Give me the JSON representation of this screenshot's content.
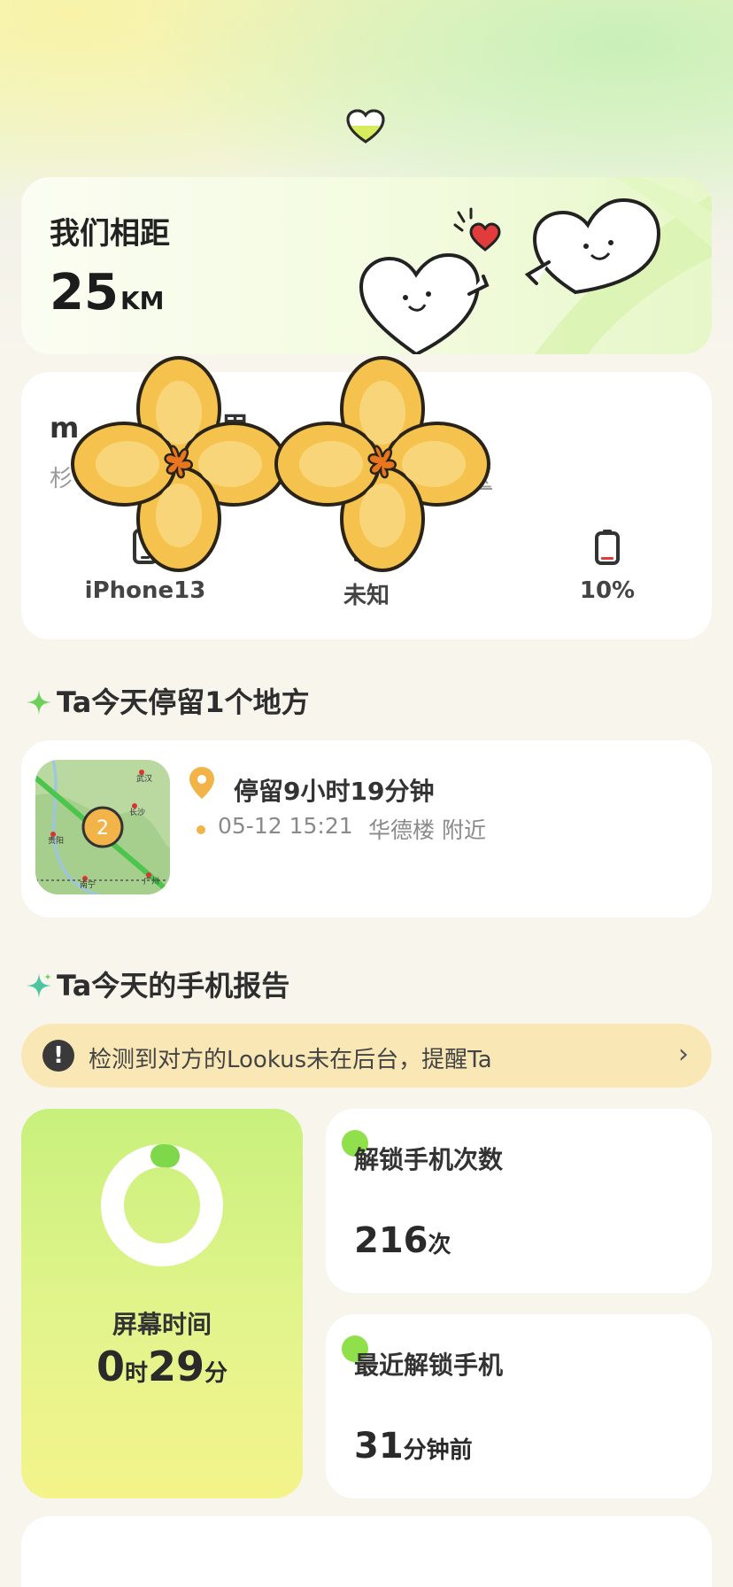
{
  "distance": {
    "title": "我们相距",
    "value": "25",
    "unit": "KM"
  },
  "location": {
    "name": "m　　　在这里",
    "sub_left": "杉",
    "sub_right": "区",
    "stats": [
      {
        "icon": "phone-icon",
        "label": "iPhone13"
      },
      {
        "icon": "signal-icon",
        "label": "未知"
      },
      {
        "icon": "battery-icon",
        "label": "10%",
        "level": 0.1
      }
    ]
  },
  "stays_section": {
    "title": "Ta今天停留1个地方"
  },
  "stay": {
    "cluster_count": "2",
    "map_labels": [
      "武汉",
      "长沙",
      "贵阳",
      "南宁",
      "广州"
    ],
    "duration": "停留9小时19分钟",
    "time": "05-12 15:21",
    "place": "华德楼 附近"
  },
  "report_section": {
    "title": "Ta今天的手机报告"
  },
  "alert": {
    "text": "检测到对方的Lookus未在后台，提醒Ta",
    "icon": "exclamation-icon"
  },
  "screen_time": {
    "label": "屏幕时间",
    "hours": "0",
    "hours_unit": "时",
    "minutes": "29",
    "minutes_unit": "分",
    "fraction_of_day": 0.02
  },
  "unlock_count": {
    "title": "解锁手机次数",
    "value": "216",
    "unit": "次"
  },
  "last_unlock": {
    "title": "最近解锁手机",
    "value": "31",
    "unit": "分钟前"
  },
  "colors": {
    "accent_green": "#8fe04a",
    "alert_bg": "#f9e8b6",
    "pin_orange": "#f2b349"
  }
}
